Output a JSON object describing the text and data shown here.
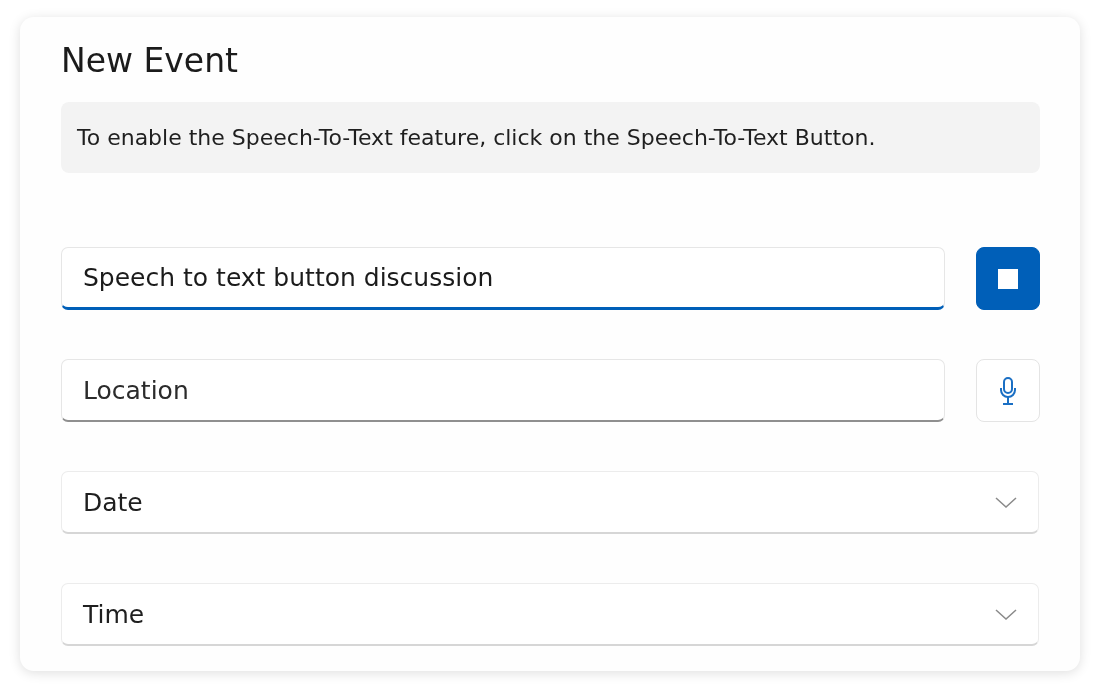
{
  "dialog": {
    "title": "New Event"
  },
  "info_bar": {
    "text": "To enable the Speech-To-Text feature, click on the Speech-To-Text Button."
  },
  "fields": [
    {
      "kind": "text",
      "value": "Speech to text button discussion",
      "focused": true,
      "speech_button": {
        "recording": true
      }
    },
    {
      "kind": "text",
      "placeholder": "Location",
      "focused": false,
      "speech_button": {
        "recording": false
      }
    },
    {
      "kind": "dropdown",
      "placeholder": "Date"
    },
    {
      "kind": "dropdown",
      "placeholder": "Time"
    }
  ]
}
